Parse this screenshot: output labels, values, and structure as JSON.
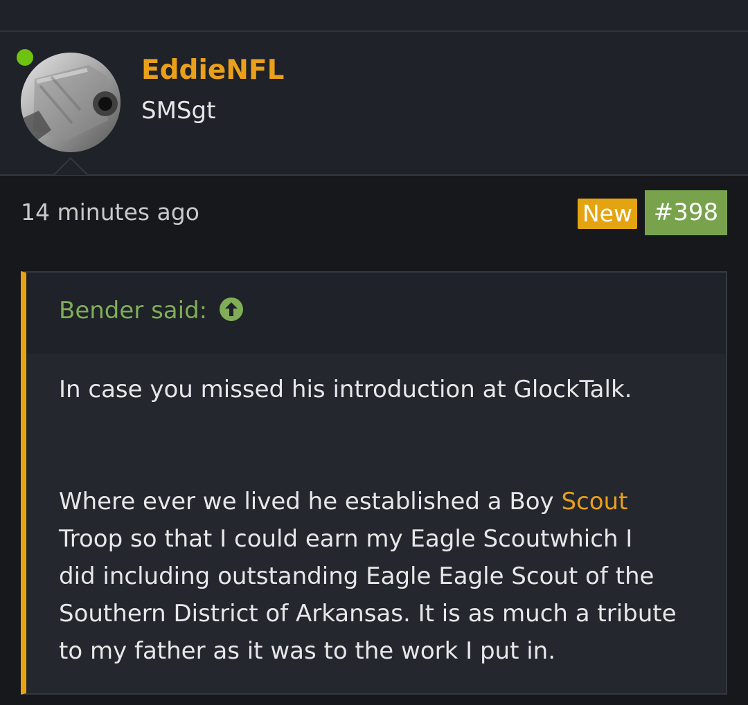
{
  "post": {
    "username": "EddieNFL",
    "user_title": "SMSgt",
    "timestamp": "14 minutes ago",
    "new_label": "New",
    "post_number": "#398"
  },
  "quote": {
    "author": "Bender said:",
    "lines": [
      "In case you missed his introduction at GlockTalk.",
      "Where ever we lived he established a Boy",
      "Scout",
      "Troop so that I could earn my Eagle Scoutwhich I",
      "did including outstanding Eagle Eagle Scout of the",
      "Southern District of Arkansas. It is as much a tribute",
      "to my father as it was to the work I put in."
    ]
  },
  "colors": {
    "page_background": "#17181c",
    "panel_background": "#1f2229",
    "quote_background": "#24272e",
    "username": "#eaa019",
    "new_badge": "#e4a411",
    "post_number": "#78a34c",
    "quote_author": "#7fae57",
    "quote_border": "#e8a313",
    "online_dot": "#6fc112"
  },
  "icons": {
    "online_status": "online-status-dot",
    "quote_jump": "arrow-up-icon"
  }
}
